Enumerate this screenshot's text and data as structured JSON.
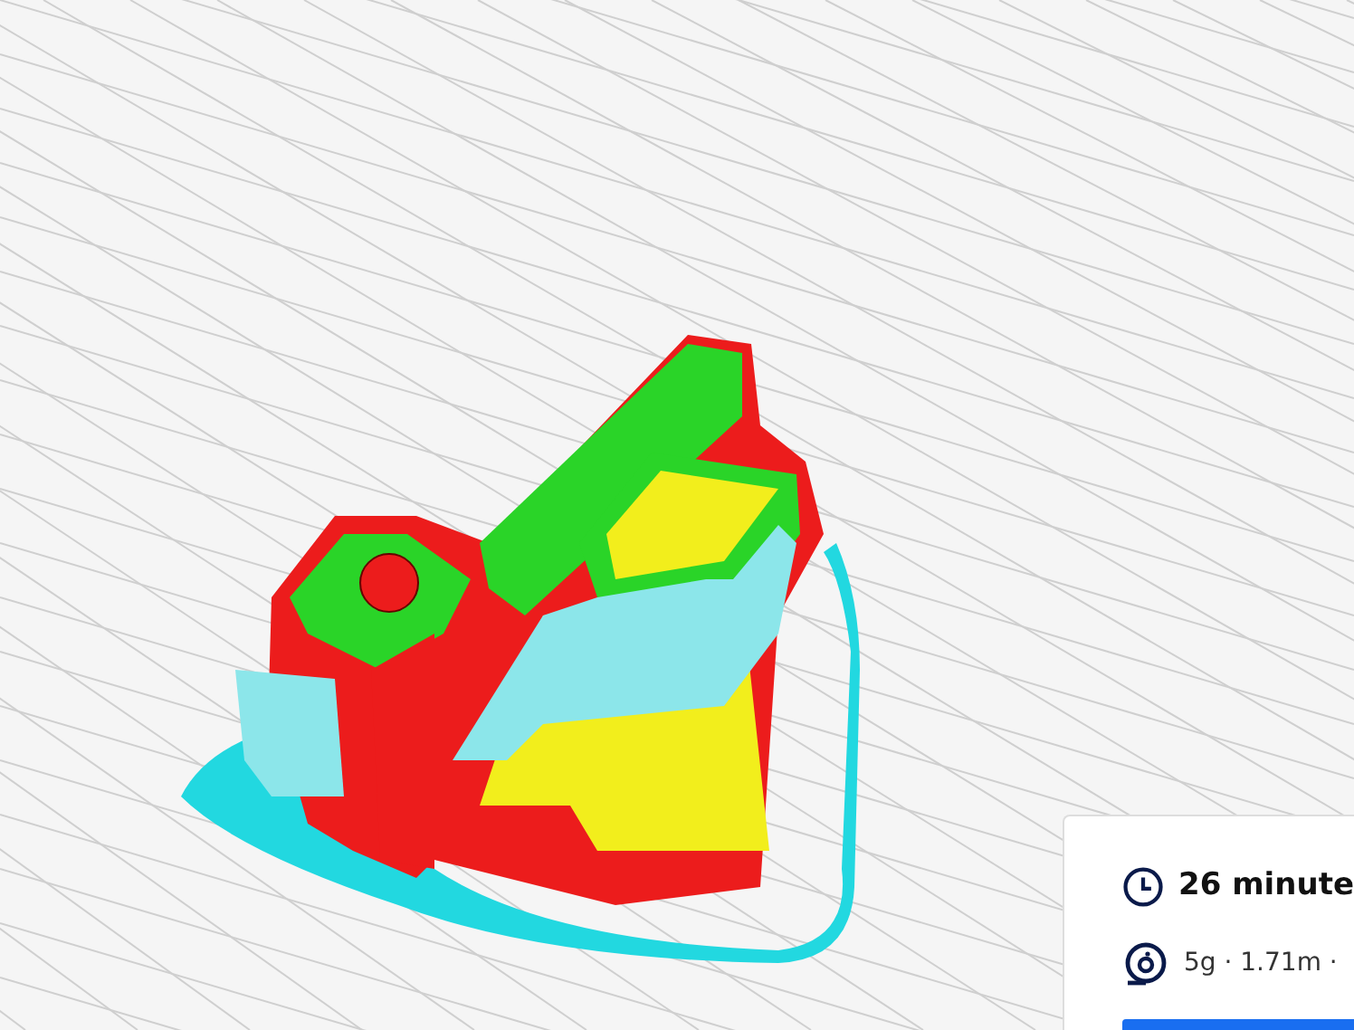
{
  "print_summary": {
    "time": "26 minute",
    "material": "5g · 1.71m ·"
  }
}
